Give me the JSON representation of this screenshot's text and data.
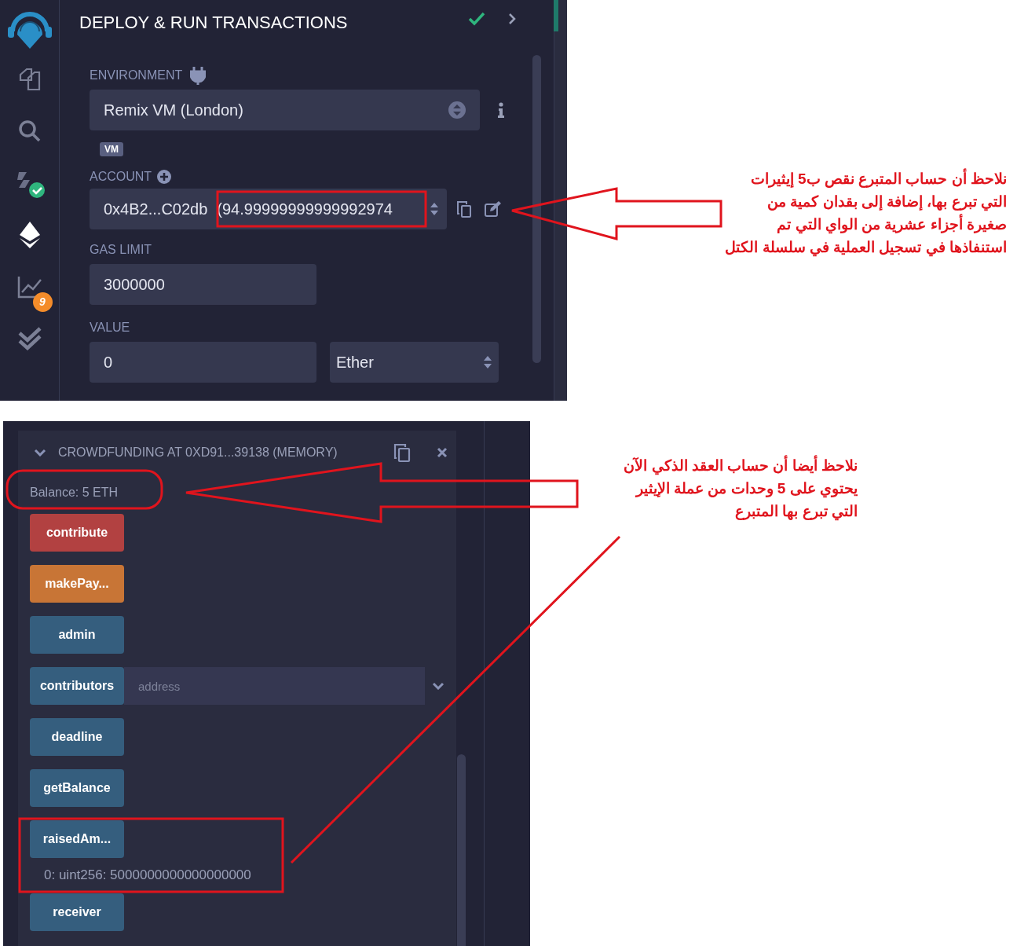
{
  "deploy_panel": {
    "title": "DEPLOY & RUN TRANSACTIONS",
    "sidebar": {
      "analysis_badge": "9"
    },
    "environment": {
      "label": "ENVIRONMENT",
      "value": "Remix VM (London)",
      "tag": "VM"
    },
    "account": {
      "label": "ACCOUNT",
      "address": "0x4B2...C02db",
      "balance": "(94.99999999999992974"
    },
    "gas_limit": {
      "label": "GAS LIMIT",
      "value": "3000000"
    },
    "value": {
      "label": "VALUE",
      "amount": "0",
      "unit": "Ether"
    }
  },
  "contract_panel": {
    "title": "CROWDFUNDING AT 0XD91...39138 (MEMORY)",
    "balance": "Balance: 5 ETH",
    "functions": [
      {
        "name": "contribute",
        "kind": "payable"
      },
      {
        "name": "makePay...",
        "kind": "transact"
      },
      {
        "name": "admin",
        "kind": "call"
      },
      {
        "name": "contributors",
        "kind": "call",
        "placeholder": "address"
      },
      {
        "name": "deadline",
        "kind": "call"
      },
      {
        "name": "getBalance",
        "kind": "call"
      },
      {
        "name": "raisedAm...",
        "kind": "call",
        "output": "0: uint256: 5000000000000000000"
      },
      {
        "name": "receiver",
        "kind": "call"
      }
    ]
  },
  "annotations": [
    {
      "lines": [
        "نلاحظ أن حساب المتبرع نقص ب5 إيثيرات",
        "التي تبرع بها، إضافة إلى بقدان كمية من",
        "صغيرة أجزاء عشرية من الواي التي تم",
        "استنفاذها في تسجيل العملية في سلسلة الكتل"
      ]
    },
    {
      "lines": [
        "نلاحظ أيضا أن حساب العقد الذكي الآن",
        "يحتوي على 5 وحدات من عملة الإيثير",
        "التي تبرع بها المتبرع"
      ]
    }
  ]
}
